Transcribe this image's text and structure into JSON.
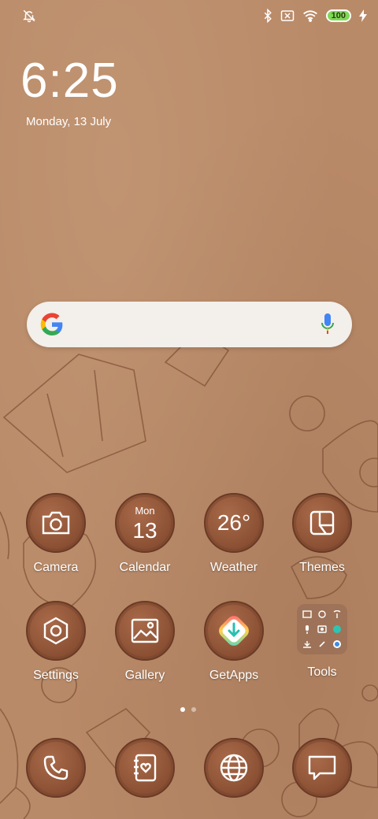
{
  "status_bar": {
    "battery_level": "100",
    "icons": [
      "notifications-off-icon",
      "bluetooth-icon",
      "no-sim-icon",
      "wifi-icon",
      "battery-icon",
      "charging-icon"
    ]
  },
  "clock": {
    "time": "6:25",
    "date": "Monday, 13 July"
  },
  "apps": [
    {
      "label": "Camera"
    },
    {
      "label": "Calendar",
      "month": "Mon",
      "day": "13"
    },
    {
      "label": "Weather",
      "temp": "26°"
    },
    {
      "label": "Themes"
    },
    {
      "label": "Settings"
    },
    {
      "label": "Gallery"
    },
    {
      "label": "GetApps"
    },
    {
      "label": "Tools"
    }
  ],
  "dock": [
    "phone-icon",
    "contacts-icon",
    "browser-icon",
    "messages-icon"
  ],
  "page_indicator": {
    "pages": 2,
    "current": 1
  },
  "colors": {
    "wallpaper": "#b98a68",
    "icon_circle": "#8a4f33",
    "battery": "#7ed957"
  }
}
